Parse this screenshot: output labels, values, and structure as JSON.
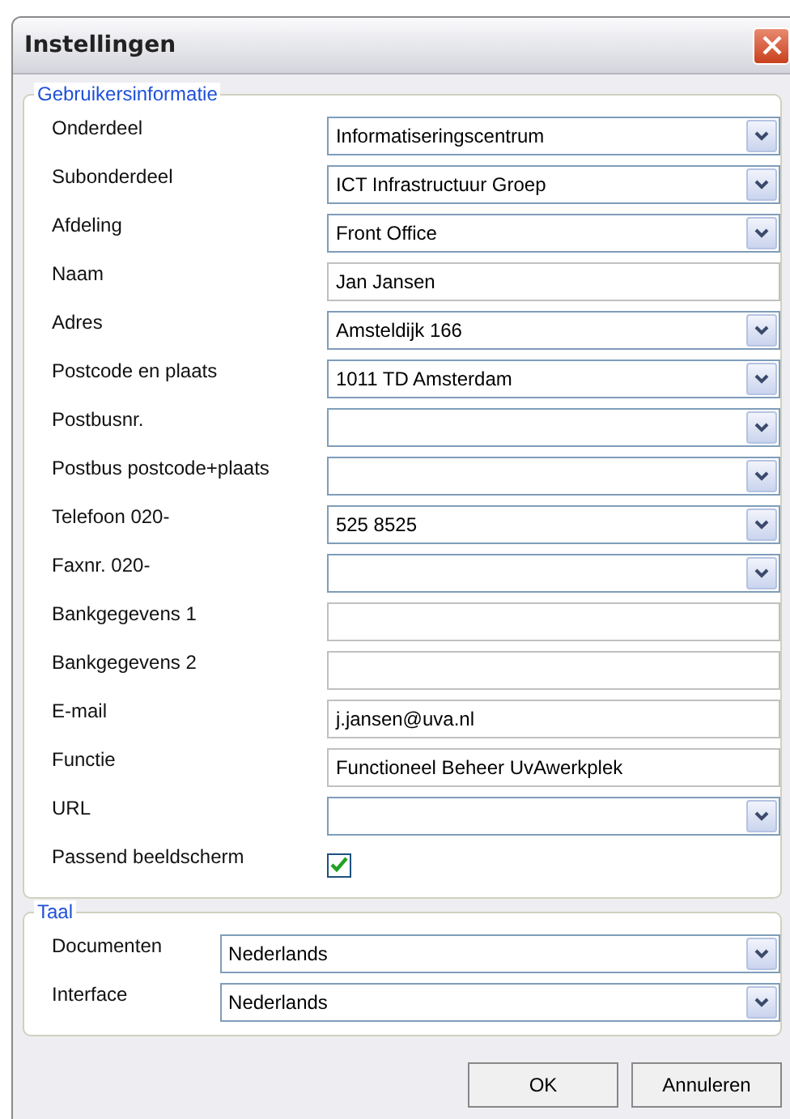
{
  "window": {
    "title": "Instellingen"
  },
  "groups": [
    {
      "title": "Gebruikersinformatie",
      "rows": [
        {
          "label": "Onderdeel",
          "kind": "combo",
          "value": "Informatiseringscentrum"
        },
        {
          "label": "Subonderdeel",
          "kind": "combo",
          "value": "ICT Infrastructuur Groep"
        },
        {
          "label": "Afdeling",
          "kind": "combo",
          "value": "Front Office"
        },
        {
          "label": "Naam",
          "kind": "text",
          "value": "Jan Jansen"
        },
        {
          "label": "Adres",
          "kind": "combo",
          "value": "Amsteldijk 166"
        },
        {
          "label": "Postcode en plaats",
          "kind": "combo",
          "value": "1011 TD Amsterdam"
        },
        {
          "label": "Postbusnr.",
          "kind": "combo"
        },
        {
          "label": "Postbus postcode+plaats",
          "kind": "combo"
        },
        {
          "label": "Telefoon 020-",
          "kind": "combo",
          "value": "525 8525"
        },
        {
          "label": "Faxnr. 020-",
          "kind": "combo"
        },
        {
          "label": "Bankgegevens 1",
          "kind": "text"
        },
        {
          "label": "Bankgegevens 2",
          "kind": "text"
        },
        {
          "label": "E-mail",
          "kind": "text",
          "value": "j.jansen@uva.nl"
        },
        {
          "label": "Functie",
          "kind": "text",
          "value": "Functioneel Beheer UvAwerkplek"
        },
        {
          "label": "URL",
          "kind": "combo"
        },
        {
          "label": "Passend beeldscherm",
          "kind": "checkbox",
          "checked": true
        }
      ]
    },
    {
      "title": "Taal",
      "rows": [
        {
          "label": "Documenten",
          "kind": "combo",
          "value": "Nederlands"
        },
        {
          "label": "Interface",
          "kind": "combo",
          "value": "Nederlands"
        }
      ]
    }
  ],
  "buttons": [
    "OK",
    "Annuleren"
  ]
}
